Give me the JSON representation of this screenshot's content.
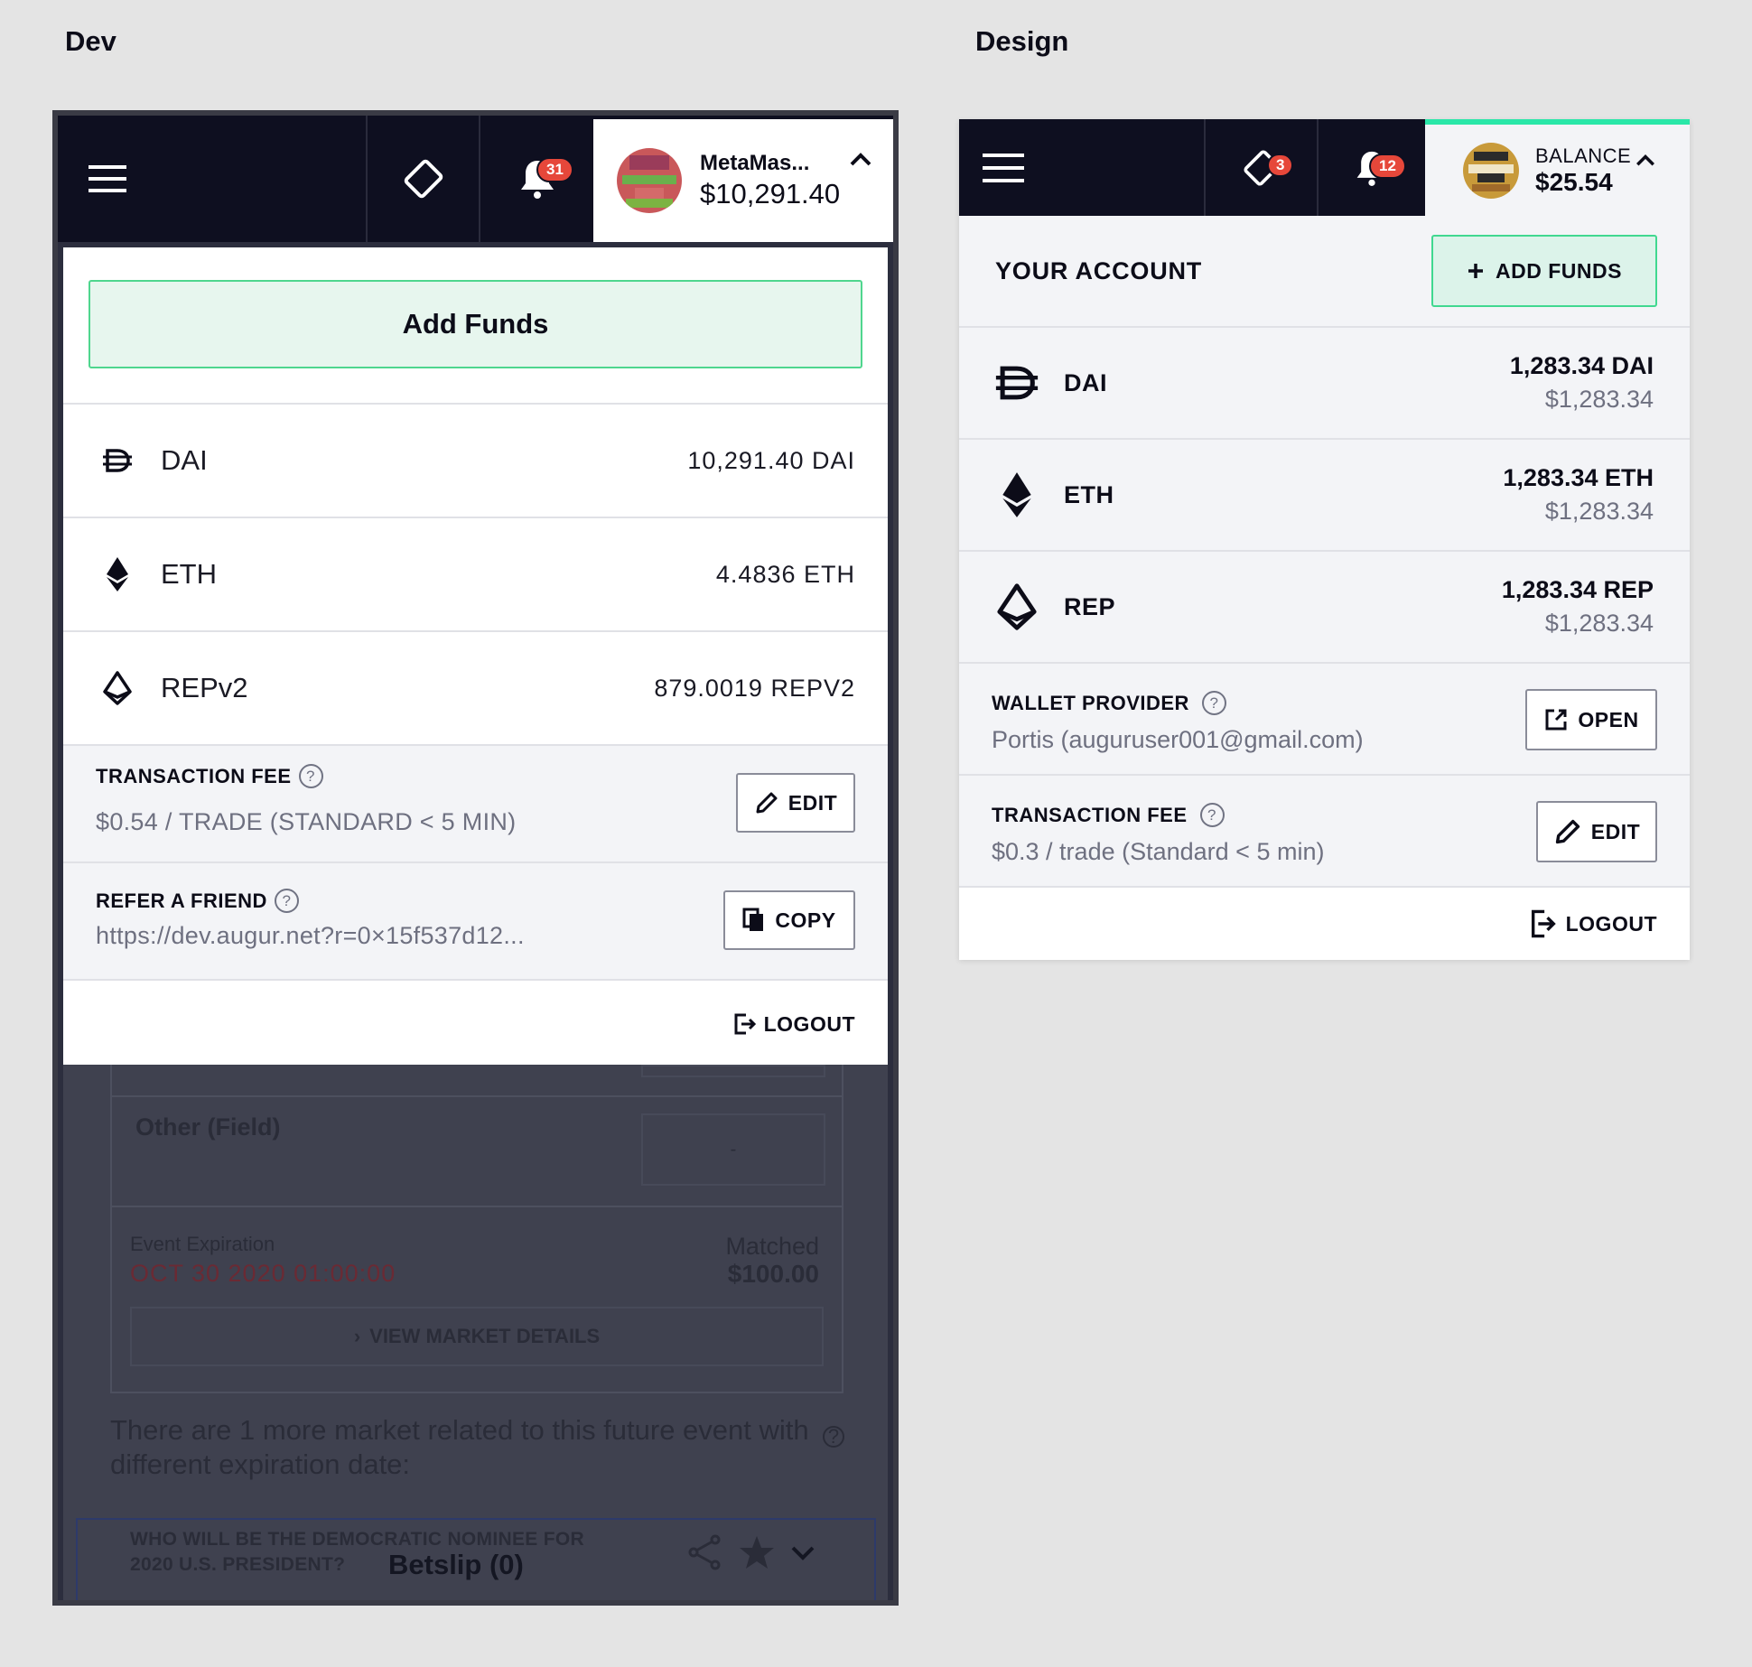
{
  "labels": {
    "dev": "Dev",
    "design": "Design"
  },
  "dev": {
    "header": {
      "bets_badge": "31",
      "account_name": "MetaMas...",
      "account_balance": "$10,291.40"
    },
    "add_funds": "Add Funds",
    "balances": [
      {
        "currency": "DAI",
        "amount": "10,291.40 DAI",
        "icon": "dai-icon"
      },
      {
        "currency": "ETH",
        "amount": "4.4836 ETH",
        "icon": "eth-icon"
      },
      {
        "currency": "REPv2",
        "amount": "879.0019 REPV2",
        "icon": "rep-icon"
      }
    ],
    "transaction_fee": {
      "label": "TRANSACTION FEE",
      "value": "$0.54 / TRADE (STANDARD < 5 MIN)",
      "button": "EDIT"
    },
    "refer": {
      "label": "REFER A FRIEND",
      "value": "https://dev.augur.net?r=0×15f537d12...",
      "button": "COPY"
    },
    "logout": "LOGOUT",
    "background": {
      "outcome": "Other (Field)",
      "outcome_value": "-",
      "expiration_label": "Event Expiration",
      "expiration_date": "OCT 30 2020 01:00:00",
      "matched_label": "Matched",
      "matched_value": "$100.00",
      "view_details": "VIEW MARKET DETAILS",
      "related_text": "There are 1 more market related to this future event with different expiration date:",
      "related_market": "WHO WILL BE THE DEMOCRATIC NOMINEE FOR 2020 U.S. PRESIDENT?",
      "betslip": "Betslip (0)"
    }
  },
  "design": {
    "header": {
      "bets_badge": "3",
      "notifications_badge": "12",
      "balance_label": "BALANCE",
      "balance": "$25.54"
    },
    "account_title": "YOUR ACCOUNT",
    "add_funds": "ADD FUNDS",
    "balances": [
      {
        "currency": "DAI",
        "amount": "1,283.34 DAI",
        "usd": "$1,283.34",
        "icon": "dai-icon"
      },
      {
        "currency": "ETH",
        "amount": "1,283.34 ETH",
        "usd": "$1,283.34",
        "icon": "eth-icon"
      },
      {
        "currency": "REP",
        "amount": "1,283.34 REP",
        "usd": "$1,283.34",
        "icon": "rep-icon"
      }
    ],
    "wallet_provider": {
      "label": "WALLET PROVIDER",
      "value": "Portis (auguruser001@gmail.com)",
      "button": "OPEN"
    },
    "transaction_fee": {
      "label": "TRANSACTION FEE",
      "value": "$0.3 / trade (Standard < 5 min)",
      "button": "EDIT"
    },
    "logout": "LOGOUT"
  }
}
